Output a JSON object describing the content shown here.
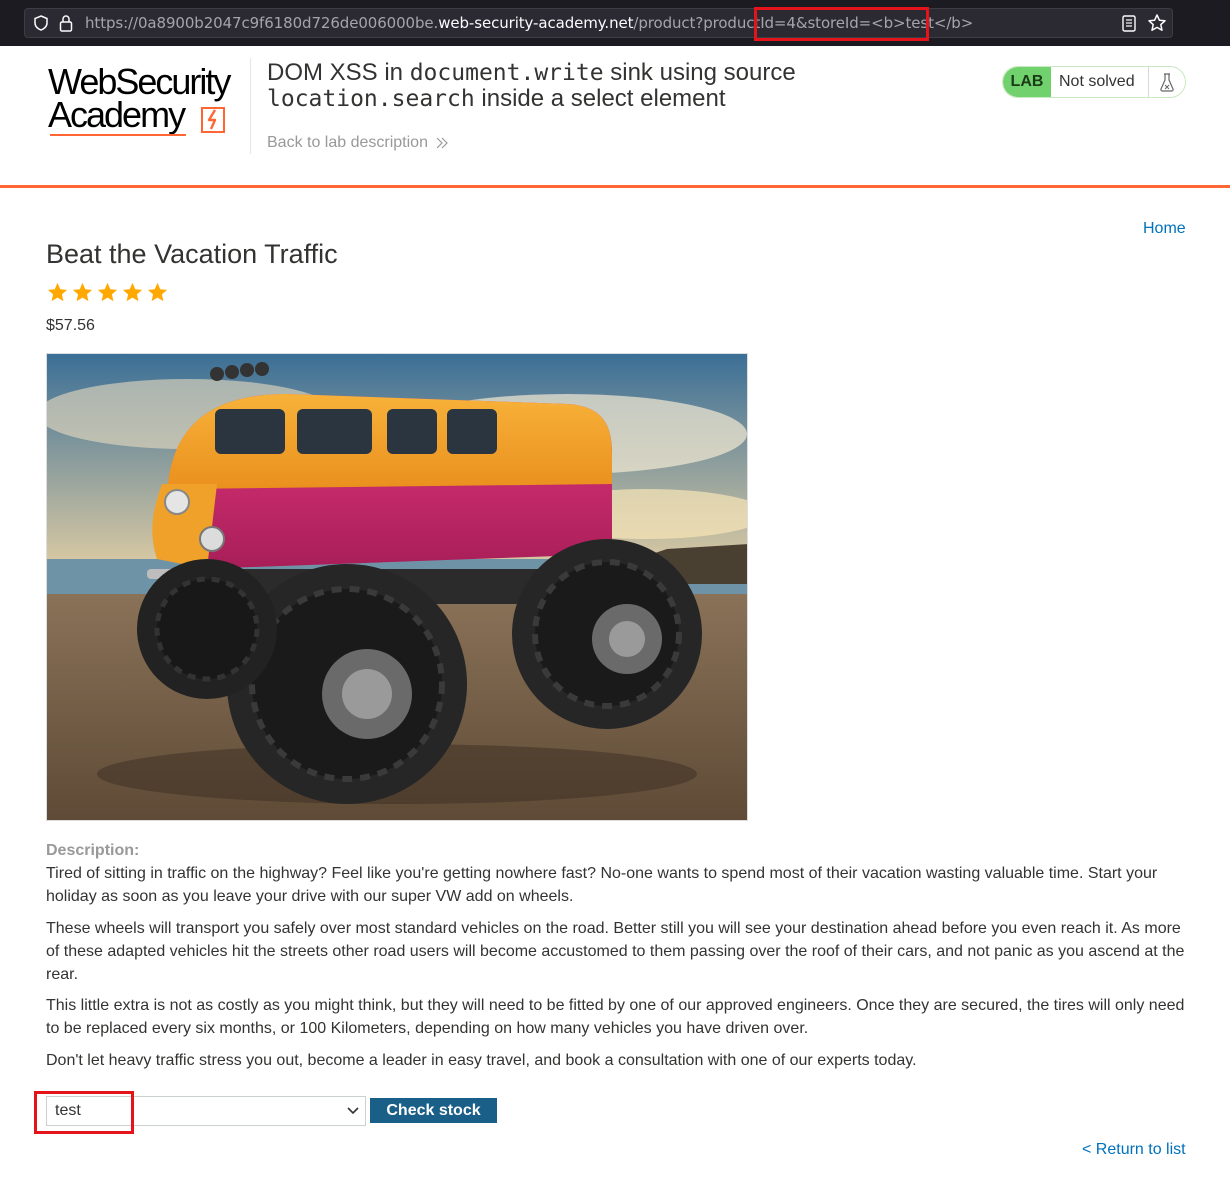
{
  "browser": {
    "url_prefix": "https://0a8900b2047c9f6180d726de006000be.",
    "url_domain": "web-security-academy.net",
    "url_path": "/product?productId=4&storeId=<b>test</b>"
  },
  "header": {
    "logo_line1": "WebSecurity",
    "logo_line2": "Academy",
    "title_part1": "DOM XSS in ",
    "title_code1": "document.write",
    "title_part2": " sink using source",
    "title_code2": "location.search",
    "title_part3": " inside a select element",
    "back_link": "Back to lab description",
    "lab_badge": "LAB",
    "status": "Not solved"
  },
  "nav": {
    "home": "Home"
  },
  "product": {
    "title": "Beat the Vacation Traffic",
    "rating": 5,
    "price": "$57.56",
    "description_label": "Description:",
    "paragraphs": [
      "Tired of sitting in traffic on the highway? Feel like you're getting nowhere fast? No-one wants to spend most of their vacation wasting valuable time. Start your holiday as soon as you leave your drive with our super VW add on wheels.",
      "These wheels will transport you safely over most standard vehicles on the road. Better still you will see your destination ahead before you even reach it. As more of these adapted vehicles hit the streets other road users will become accustomed to them passing over the roof of their cars, and not panic as you ascend at the rear.",
      "This little extra is not as costly as you might think, but they will need to be fitted by one of our approved engineers. Once they are secured, the tires will only need to be replaced every six months, or 100 Kilometers, depending on how many vehicles you have driven over.",
      "Don't let heavy traffic stress you out, become a leader in easy travel, and book a consultation with one of our experts today."
    ]
  },
  "stock": {
    "selected_store": "test",
    "button": "Check stock"
  },
  "footer": {
    "return_link": "< Return to list"
  },
  "colors": {
    "accent": "#ff6633",
    "link": "#0071bc",
    "button": "#1a5f88",
    "star": "#ffa800",
    "highlight": "#e5141b",
    "lab_green": "#70d16d"
  }
}
